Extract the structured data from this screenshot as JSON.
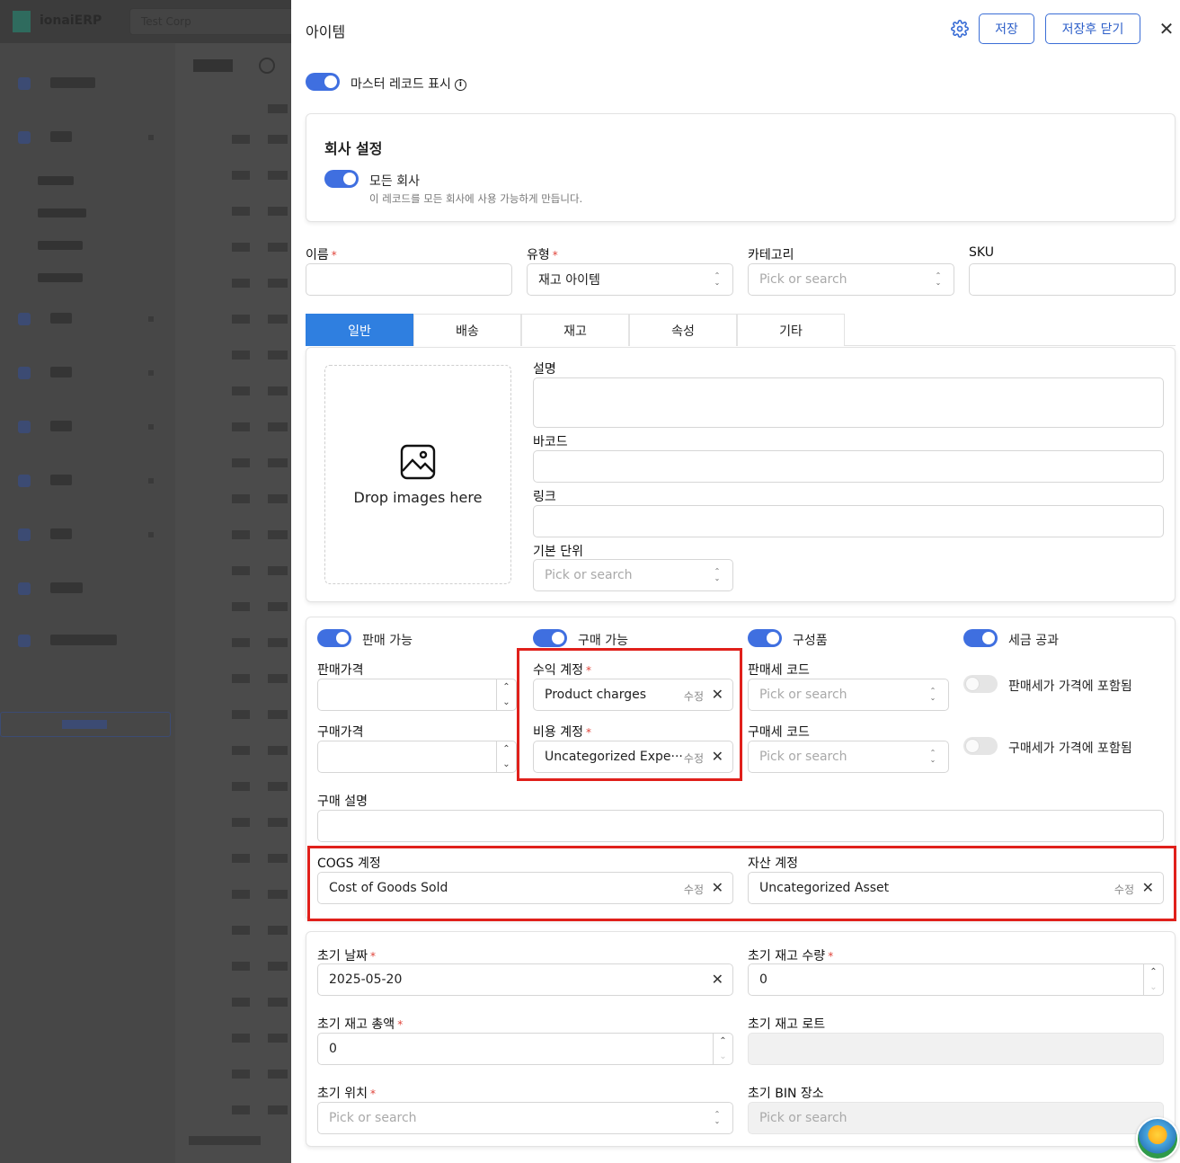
{
  "background": {
    "brand": "ionaiERP",
    "company": "Test Corp"
  },
  "header": {
    "title": "아이템",
    "save": "저장",
    "save_close": "저장후 닫기"
  },
  "master_record": {
    "label": "마스터 레코드 표시",
    "enabled": true
  },
  "company_settings": {
    "title": "회사 설정",
    "all_companies_label": "모든 회사",
    "all_companies_desc": "이 레코드를 모든 회사에 사용 가능하게 만듭니다.",
    "enabled": true
  },
  "basic": {
    "name_label": "이름",
    "name_value": "",
    "type_label": "유형",
    "type_value": "재고 아이템",
    "category_label": "카테고리",
    "category_placeholder": "Pick or search",
    "sku_label": "SKU",
    "sku_value": ""
  },
  "tabs": [
    "일반",
    "배송",
    "재고",
    "속성",
    "기타"
  ],
  "general": {
    "drop_text": "Drop images here",
    "description_label": "설명",
    "barcode_label": "바코드",
    "link_label": "링크",
    "unit_label": "기본 단위",
    "unit_placeholder": "Pick or search"
  },
  "accounting": {
    "sellable_label": "판매 가능",
    "purchasable_label": "구매 가능",
    "component_label": "구성품",
    "taxable_label": "세금 공과",
    "sale_price_label": "판매가격",
    "purchase_price_label": "구매가격",
    "income_account_label": "수익 계정",
    "income_account_value": "Product charges",
    "expense_account_label": "비용 계정",
    "expense_account_value": "Uncategorized Expe···",
    "edit_label": "수정",
    "sales_tax_code_label": "판매세 코드",
    "purchase_tax_code_label": "구매세 코드",
    "tax_placeholder": "Pick or search",
    "sales_tax_incl_label": "판매세가 가격에 포함됨",
    "purchase_tax_incl_label": "구매세가 가격에 포함됨",
    "purchase_desc_label": "구매 설명",
    "cogs_label": "COGS 계정",
    "cogs_value": "Cost of Goods Sold",
    "asset_label": "자산 계정",
    "asset_value": "Uncategorized Asset"
  },
  "initial": {
    "date_label": "초기 날짜",
    "date_value": "2025-05-20",
    "qty_label": "초기 재고 수량",
    "qty_value": "0",
    "total_label": "초기 재고 총액",
    "total_value": "0",
    "lot_label": "초기 재고 로트",
    "location_label": "초기 위치",
    "location_placeholder": "Pick or search",
    "bin_label": "초기 BIN 장소",
    "bin_placeholder": "Pick or search"
  },
  "colors": {
    "primary": "#3f6fe0",
    "tab_active": "#2f7fe0",
    "highlight": "#e0201b"
  }
}
